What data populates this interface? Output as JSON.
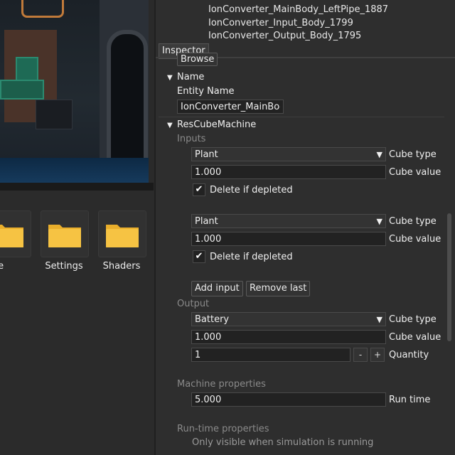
{
  "hierarchy": {
    "items": [
      "IonConverter_MainBody_LeftPipe_1887",
      "IonConverter_Input_Body_1799",
      "IonConverter_Output_Body_1795"
    ]
  },
  "inspector": {
    "tab_label": "Inspector",
    "browse_label": "Browse",
    "name_section": {
      "title": "Name",
      "entity_name_label": "Entity Name",
      "entity_name_value": "IonConverter_MainBody"
    },
    "rescube": {
      "title": "ResCubeMachine",
      "inputs_label": "Inputs",
      "inputs": [
        {
          "cube_type": "Plant",
          "cube_type_label": "Cube type",
          "cube_value": "1.000",
          "cube_value_label": "Cube value",
          "delete_label": "Delete if depleted",
          "delete_checked": true
        },
        {
          "cube_type": "Plant",
          "cube_type_label": "Cube type",
          "cube_value": "1.000",
          "cube_value_label": "Cube value",
          "delete_label": "Delete if depleted",
          "delete_checked": true
        }
      ],
      "add_input_label": "Add input",
      "remove_last_label": "Remove last",
      "output_label": "Output",
      "output": {
        "cube_type": "Battery",
        "cube_type_label": "Cube type",
        "cube_value": "1.000",
        "cube_value_label": "Cube value",
        "quantity": "1",
        "quantity_label": "Quantity",
        "minus_label": "-",
        "plus_label": "+"
      },
      "machine_properties_label": "Machine properties",
      "run_time_value": "5.000",
      "run_time_label": "Run time",
      "runtime_properties_label": "Run-time properties",
      "runtime_note": "Only visible when simulation is running"
    }
  },
  "assets": {
    "folders": [
      {
        "label": "ne",
        "icon": "folder-icon"
      },
      {
        "label": "Settings",
        "icon": "folder-icon"
      },
      {
        "label": "Shaders",
        "icon": "folder-icon"
      }
    ]
  },
  "colors": {
    "folder": "#f6c343",
    "folder_tab": "#e9ae2b",
    "panel_bg": "#2e2e2e"
  }
}
